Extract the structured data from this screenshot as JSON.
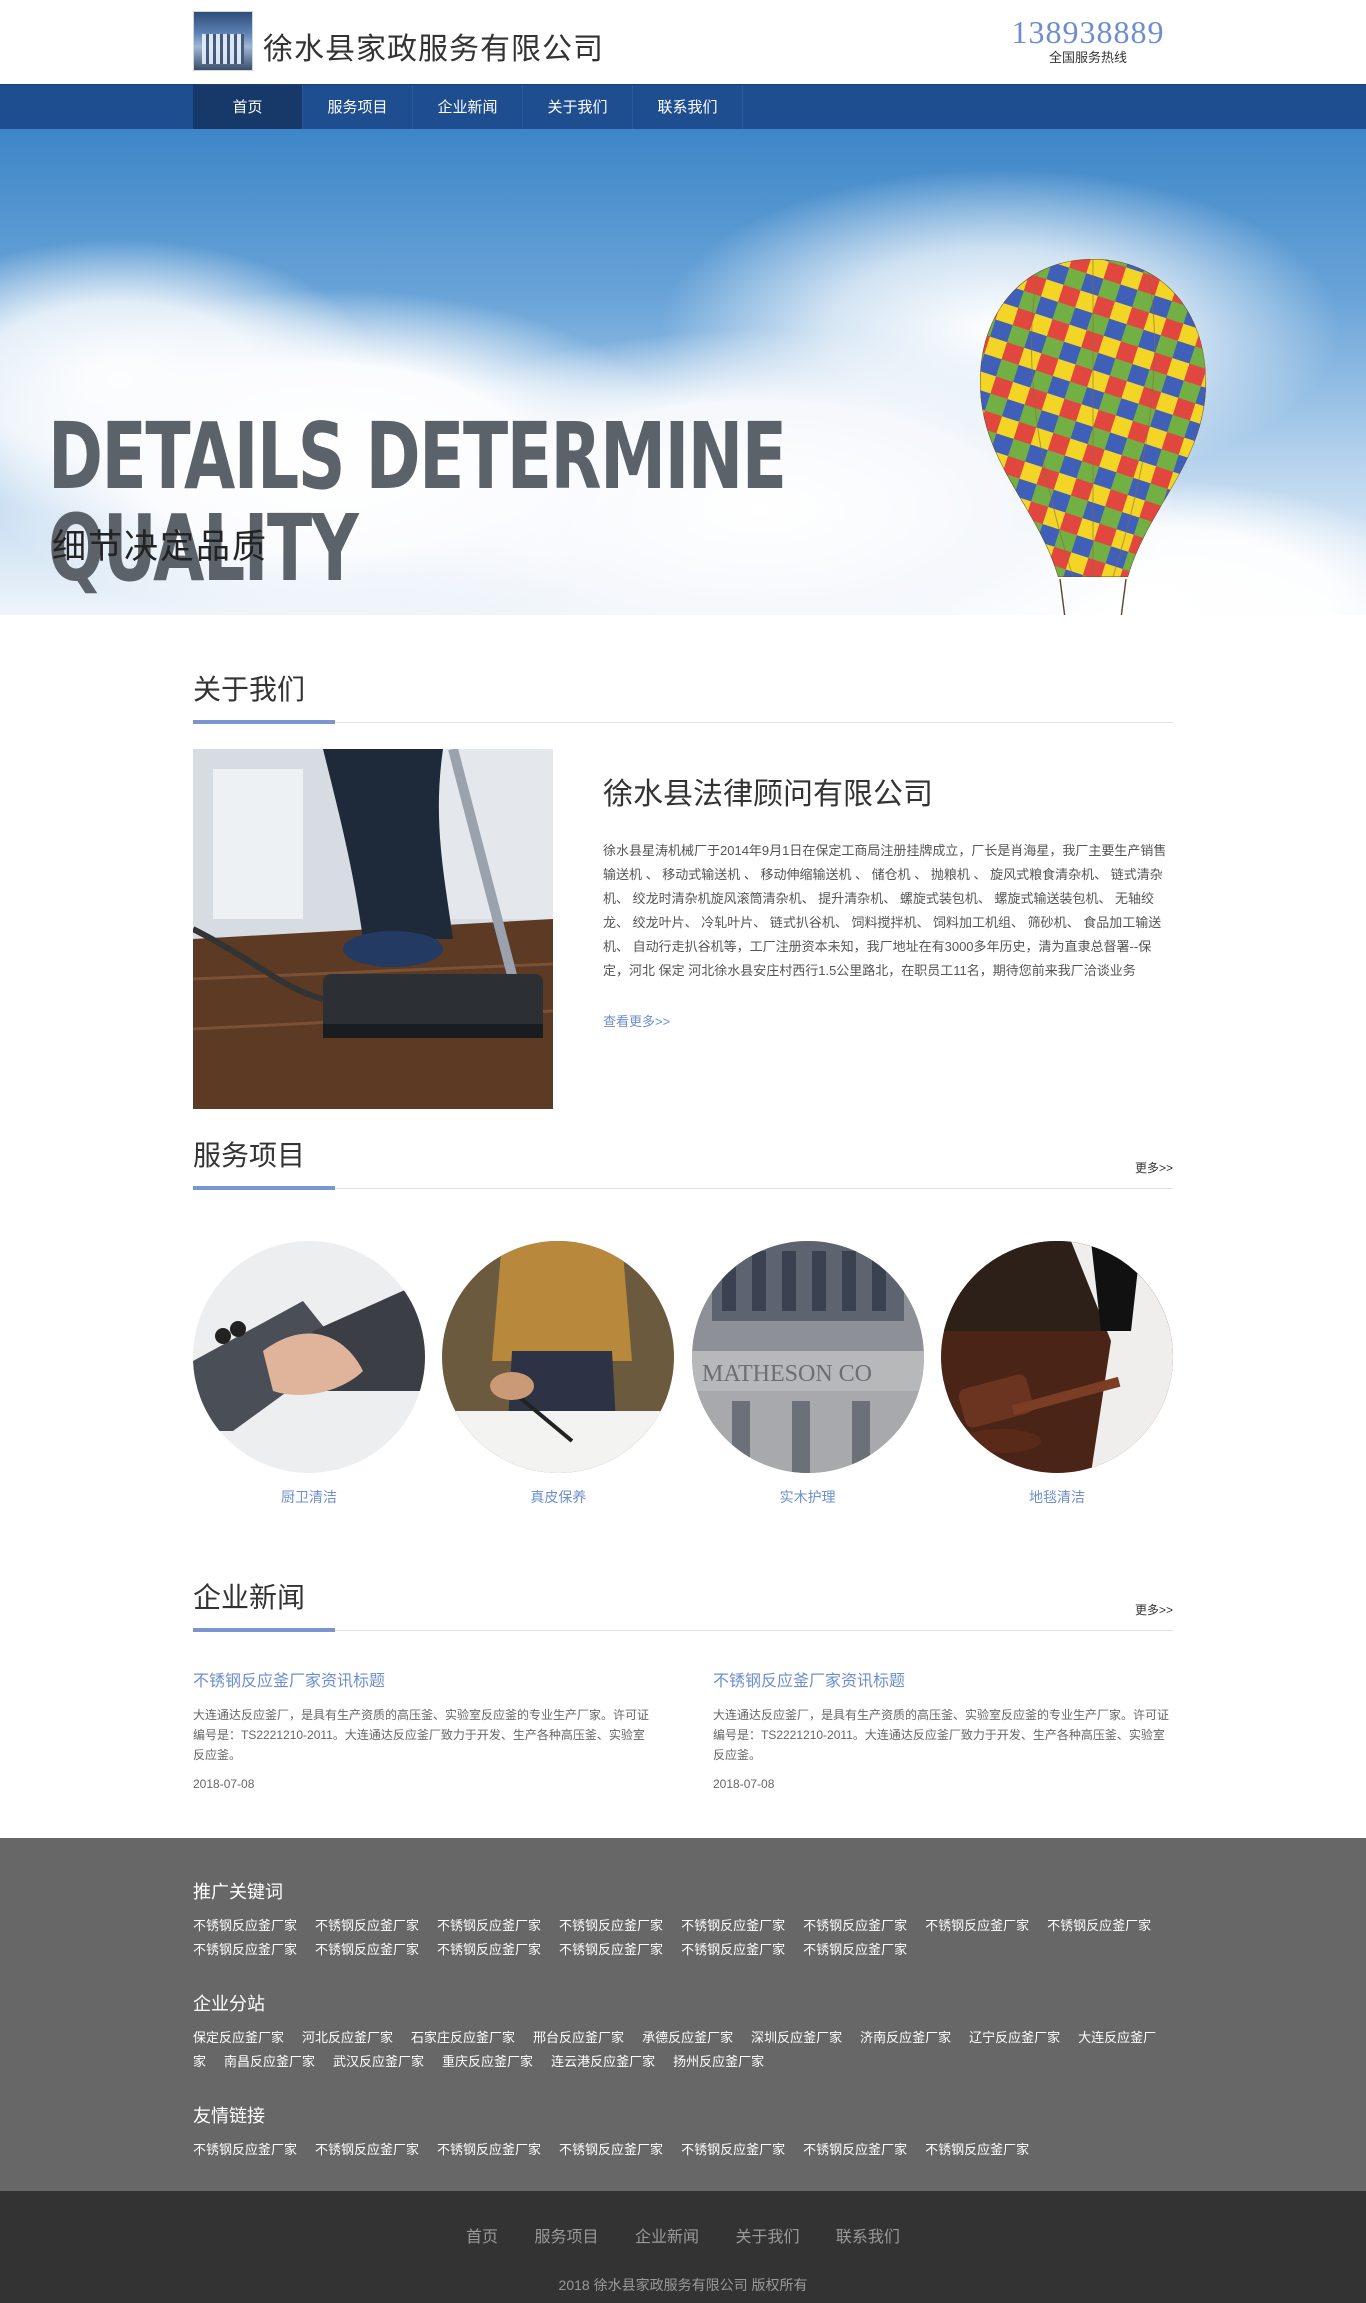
{
  "header": {
    "site_name": "徐水县家政服务有限公司",
    "phone": "138938889",
    "phone_label": "全国服务热线"
  },
  "nav": {
    "items": [
      "首页",
      "服务项目",
      "企业新闻",
      "关于我们",
      "联系我们"
    ],
    "active_index": 0
  },
  "banner": {
    "headline_en": "DETAILS DETERMINE QUALITY",
    "headline_cn": "细节决定品质"
  },
  "about": {
    "section_title": "关于我们",
    "company_name": "徐水县法律顾问有限公司",
    "description": "徐水县星涛机械厂于2014年9月1日在保定工商局注册挂牌成立，厂长是肖海星，我厂主要生产销售 输送机 、 移动式输送机 、 移动伸缩输送机 、 储仓机 、 抛粮机 、 旋风式粮食清杂机、 链式清杂机、 绞龙时清杂机旋风滚筒清杂机、 提升清杂机、 螺旋式装包机、 螺旋式输送装包机、 无轴绞龙、 绞龙叶片、 冷轧叶片、 链式扒谷机、 饲料搅拌机、 饲料加工机组、 筛砂机、 食品加工输送机、 自动行走扒谷机等，工厂注册资本未知，我厂地址在有3000多年历史，清为直隶总督署--保定，河北 保定 河北徐水县安庄村西行1.5公里路北，在职员工11名，期待您前来我厂洽谈业务",
    "see_more": "查看更多>>"
  },
  "services": {
    "section_title": "服务项目",
    "more": "更多>>",
    "items": [
      {
        "label": "厨卫清洁",
        "image": "handshake-photo"
      },
      {
        "label": "真皮保养",
        "image": "signing-photo"
      },
      {
        "label": "实木护理",
        "image": "building-photo"
      },
      {
        "label": "地毯清洁",
        "image": "gavel-photo"
      }
    ]
  },
  "news": {
    "section_title": "企业新闻",
    "more": "更多>>",
    "items": [
      {
        "title": "不锈钢反应釜厂家资讯标题",
        "desc": "大连通达反应釜厂，是具有生产资质的高压釜、实验室反应釜的专业生产厂家。许可证编号是：TS2221210-2011。大连通达反应釜厂致力于开发、生产各种高压釜、实验室反应釜。",
        "date": "2018-07-08"
      },
      {
        "title": "不锈钢反应釜厂家资讯标题",
        "desc": "大连通达反应釜厂，是具有生产资质的高压釜、实验室反应釜的专业生产厂家。许可证编号是：TS2221210-2011。大连通达反应釜厂致力于开发、生产各种高压釜、实验室反应釜。",
        "date": "2018-07-08"
      }
    ]
  },
  "footer": {
    "keywords_title": "推广关键词",
    "keywords": [
      "不锈钢反应釜厂家",
      "不锈钢反应釜厂家",
      "不锈钢反应釜厂家",
      "不锈钢反应釜厂家",
      "不锈钢反应釜厂家",
      "不锈钢反应釜厂家",
      "不锈钢反应釜厂家",
      "不锈钢反应釜厂家",
      "不锈钢反应釜厂家",
      "不锈钢反应釜厂家",
      "不锈钢反应釜厂家",
      "不锈钢反应釜厂家",
      "不锈钢反应釜厂家",
      "不锈钢反应釜厂家"
    ],
    "branches_title": "企业分站",
    "branches": [
      "保定反应釜厂家",
      "河北反应釜厂家",
      "石家庄反应釜厂家",
      "邢台反应釜厂家",
      "承德反应釜厂家",
      "深圳反应釜厂家",
      "济南反应釜厂家",
      "辽宁反应釜厂家",
      "大连反应釜厂家",
      "南昌反应釜厂家",
      "武汉反应釜厂家",
      "重庆反应釜厂家",
      "连云港反应釜厂家",
      "扬州反应釜厂家"
    ],
    "friends_title": "友情链接",
    "friends": [
      "不锈钢反应釜厂家",
      "不锈钢反应釜厂家",
      "不锈钢反应釜厂家",
      "不锈钢反应釜厂家",
      "不锈钢反应釜厂家",
      "不锈钢反应釜厂家",
      "不锈钢反应釜厂家"
    ]
  },
  "bottom": {
    "menu": [
      "首页",
      "服务项目",
      "企业新闻",
      "关于我们",
      "联系我们"
    ],
    "copyright": "2018 徐水县家政服务有限公司 版权所有"
  },
  "colors": {
    "nav_bg": "#1f4e90",
    "accent": "#6c8ed0",
    "footer_bg": "#676767",
    "bottom_bg": "#333333"
  }
}
